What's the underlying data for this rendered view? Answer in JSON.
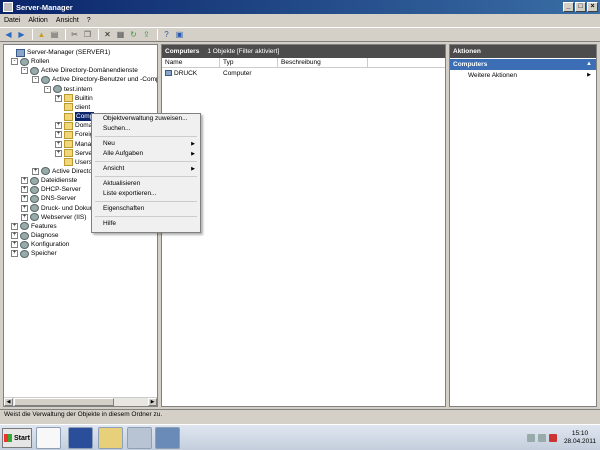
{
  "window": {
    "title": "Server-Manager"
  },
  "menu": [
    "Datei",
    "Aktion",
    "Ansicht",
    "?"
  ],
  "tree": [
    {
      "label": "Server-Manager (SERVER1)",
      "level": 0,
      "exp": ""
    },
    {
      "label": "Rollen",
      "level": 1,
      "exp": "-"
    },
    {
      "label": "Active Directory-Domänendienste",
      "level": 2,
      "exp": "-"
    },
    {
      "label": "Active Directory-Benutzer und -Compu",
      "level": 3,
      "exp": "-"
    },
    {
      "label": "test.intern",
      "level": 4,
      "exp": "-"
    },
    {
      "label": "Builtin",
      "level": 5,
      "exp": "+"
    },
    {
      "label": "client",
      "level": 5,
      "exp": ""
    },
    {
      "label": "Comp",
      "level": 5,
      "exp": "",
      "selected": true
    },
    {
      "label": "Domai",
      "level": 5,
      "exp": "+"
    },
    {
      "label": "Foreig",
      "level": 5,
      "exp": "+"
    },
    {
      "label": "Manag",
      "level": 5,
      "exp": "+"
    },
    {
      "label": "Serve",
      "level": 5,
      "exp": "+"
    },
    {
      "label": "Users",
      "level": 5,
      "exp": ""
    },
    {
      "label": "Active Directo",
      "level": 3,
      "exp": "+"
    },
    {
      "label": "Dateidienste",
      "level": 2,
      "exp": "+"
    },
    {
      "label": "DHCP-Server",
      "level": 2,
      "exp": "+"
    },
    {
      "label": "DNS-Server",
      "level": 2,
      "exp": "+"
    },
    {
      "label": "Druck- und Dokum",
      "level": 2,
      "exp": "+"
    },
    {
      "label": "Webserver (IIS)",
      "level": 2,
      "exp": "+"
    },
    {
      "label": "Features",
      "level": 1,
      "exp": "+"
    },
    {
      "label": "Diagnose",
      "level": 1,
      "exp": "+"
    },
    {
      "label": "Konfiguration",
      "level": 1,
      "exp": "+"
    },
    {
      "label": "Speicher",
      "level": 1,
      "exp": "+"
    }
  ],
  "center": {
    "title": "Computers",
    "info": "1 Objekte  [Filter aktiviert]",
    "columns": [
      "Name",
      "Typ",
      "Beschreibung"
    ],
    "rows": [
      {
        "name": "DRUCK",
        "type": "Computer",
        "desc": ""
      }
    ]
  },
  "actions": {
    "title": "Aktionen",
    "section": "Computers",
    "items": [
      "Weitere Aktionen"
    ]
  },
  "context_menu": [
    {
      "label": "Objektverwaltung zuweisen...",
      "sub": false
    },
    {
      "label": "Suchen...",
      "sub": false
    },
    {
      "sep": true
    },
    {
      "label": "Neu",
      "sub": true
    },
    {
      "label": "Alle Aufgaben",
      "sub": true
    },
    {
      "sep": true
    },
    {
      "label": "Ansicht",
      "sub": true
    },
    {
      "sep": true
    },
    {
      "label": "Aktualisieren",
      "sub": false
    },
    {
      "label": "Liste exportieren...",
      "sub": false
    },
    {
      "sep": true
    },
    {
      "label": "Eigenschaften",
      "sub": false
    },
    {
      "sep": true
    },
    {
      "label": "Hilfe",
      "sub": false
    }
  ],
  "status": "Weist die Verwaltung der Objekte in diesem Ordner zu.",
  "taskbar": {
    "start": "Start",
    "time": "15:10",
    "date": "28.04.2011"
  }
}
